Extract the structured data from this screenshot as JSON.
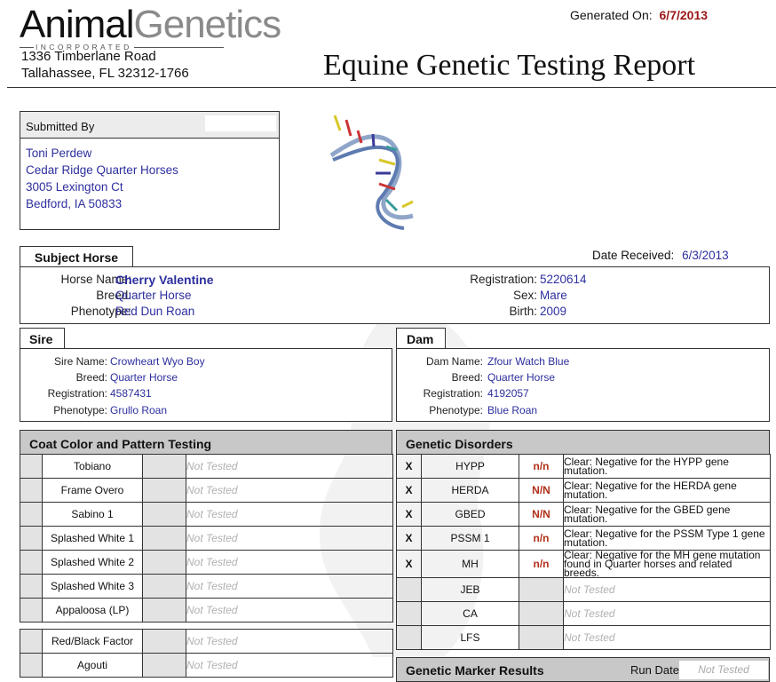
{
  "header": {
    "logo_animal": "Animal",
    "logo_genetics": "Genetics",
    "logo_inc": "INCORPORATED",
    "address_line1": "1336 Timberlane Road",
    "address_line2": "Tallahassee, FL 32312-1766",
    "generated_label": "Generated On:",
    "generated_date": "6/7/2013",
    "report_title": "Equine Genetic Testing Report"
  },
  "submitted": {
    "title": "Submitted By",
    "lines": [
      "Toni Perdew",
      "Cedar Ridge Quarter Horses",
      "3005 Lexington Ct",
      "Bedford,  IA 50833"
    ]
  },
  "subject": {
    "tab": "Subject Horse",
    "date_received_label": "Date Received:",
    "date_received": "6/3/2013",
    "horse_name_label": "Horse Name:",
    "horse_name": "Cherry Valentine",
    "breed_label": "Breed:",
    "breed": "Quarter Horse",
    "phenotype_label": "Phenotype:",
    "phenotype": "Red Dun Roan",
    "registration_label": "Registration:",
    "registration": "5220614",
    "sex_label": "Sex:",
    "sex": "Mare",
    "birth_label": "Birth:",
    "birth": "2009"
  },
  "sire": {
    "tab": "Sire",
    "name_label": "Sire Name:",
    "name": "Crowheart Wyo Boy",
    "breed_label": "Breed:",
    "breed": "Quarter Horse",
    "registration_label": "Registration:",
    "registration": "4587431",
    "phenotype_label": "Phenotype:",
    "phenotype": "Grullo Roan"
  },
  "dam": {
    "tab": "Dam",
    "name_label": "Dam Name:",
    "name": "Zfour Watch Blue",
    "breed_label": "Breed:",
    "breed": "Quarter Horse",
    "registration_label": "Registration:",
    "registration": "4192057",
    "phenotype_label": "Phenotype:",
    "phenotype": "Blue Roan"
  },
  "coat": {
    "title": "Coat Color and Pattern Testing",
    "rows": [
      {
        "name": "Tobiano",
        "status": "Not Tested"
      },
      {
        "name": "Frame Overo",
        "status": "Not Tested"
      },
      {
        "name": "Sabino 1",
        "status": "Not Tested"
      },
      {
        "name": "Splashed White 1",
        "status": "Not Tested"
      },
      {
        "name": "Splashed White 2",
        "status": "Not Tested"
      },
      {
        "name": "Splashed White 3",
        "status": "Not Tested"
      },
      {
        "name": "Appaloosa (LP)",
        "status": "Not Tested"
      }
    ],
    "rows2": [
      {
        "name": "Red/Black Factor",
        "status": "Not Tested"
      },
      {
        "name": "Agouti",
        "status": "Not Tested"
      }
    ]
  },
  "disorders": {
    "title": "Genetic Disorders",
    "rows": [
      {
        "mark": "X",
        "name": "HYPP",
        "result": "n/n",
        "desc": "Clear: Negative for the HYPP gene mutation."
      },
      {
        "mark": "X",
        "name": "HERDA",
        "result": "N/N",
        "desc": "Clear: Negative for the HERDA gene mutation."
      },
      {
        "mark": "X",
        "name": "GBED",
        "result": "N/N",
        "desc": "Clear: Negative for the GBED gene mutation."
      },
      {
        "mark": "X",
        "name": "PSSM 1",
        "result": "n/n",
        "desc": "Clear: Negative for the PSSM Type 1 gene mutation."
      },
      {
        "mark": "X",
        "name": "MH",
        "result": "n/n",
        "desc": "Clear: Negative for the MH gene mutation found in Quarter horses and related breeds."
      },
      {
        "mark": "",
        "name": "JEB",
        "result": "",
        "desc": "Not Tested"
      },
      {
        "mark": "",
        "name": "CA",
        "result": "",
        "desc": "Not Tested"
      },
      {
        "mark": "",
        "name": "LFS",
        "result": "",
        "desc": "Not Tested"
      }
    ]
  },
  "markers": {
    "title": "Genetic Marker Results",
    "run_date_label": "Run Date:",
    "run_date": "Not Tested"
  },
  "colors": {
    "accent_blue": "#2d2f9e",
    "date_red": "#9b1515",
    "header_gray": "#c8c8c8"
  }
}
